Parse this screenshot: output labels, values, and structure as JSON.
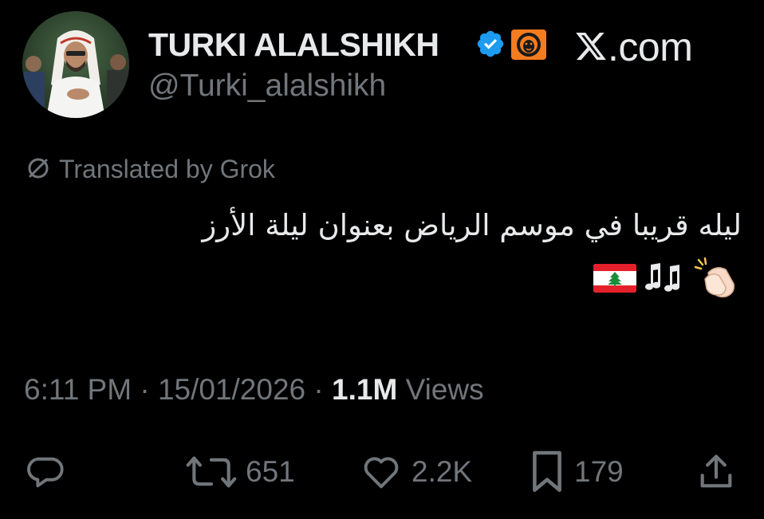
{
  "header": {
    "display_name": "TURKI ALALSHIKH",
    "handle": "@Turki_alalshikh",
    "site_label": ".com",
    "avatar_icon": "profile-photo",
    "verified_icon": "verified-check-icon",
    "affiliate_icon": "lion-badge-icon"
  },
  "translation": {
    "label": "Translated by Grok",
    "icon": "translate-icon"
  },
  "tweet": {
    "text": "ليله قريبا في موسم الرياض بعنوان ليلة الأرز",
    "emojis": [
      "lebanon-flag",
      "musical-notes",
      "clapping-hands"
    ]
  },
  "meta": {
    "time": "6:11 PM",
    "separator": "·",
    "date": "15/01/2026",
    "views_count": "1.1M",
    "views_label": "Views"
  },
  "actions": {
    "reply_count": "",
    "retweet_count": "651",
    "like_count": "2.2K",
    "bookmark_count": "179"
  },
  "colors": {
    "background": "#000000",
    "primary_text": "#e7e9ea",
    "secondary_text": "#71767b",
    "verified_blue": "#1d9bf0",
    "affiliate_orange": "#f47c20"
  }
}
